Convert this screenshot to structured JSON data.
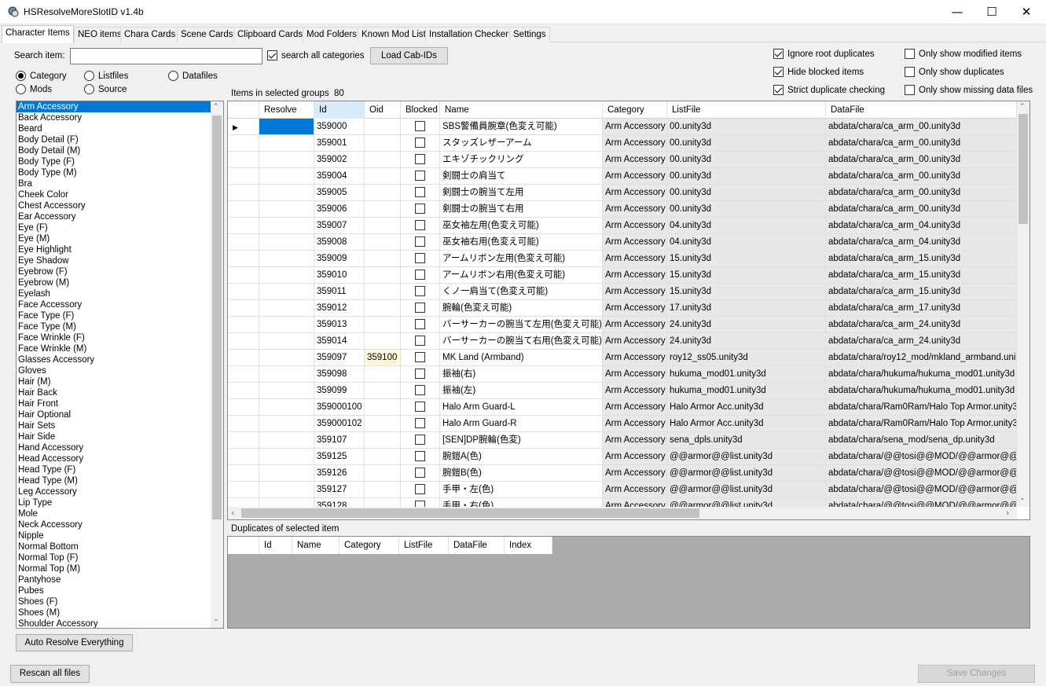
{
  "window": {
    "title": "HSResolveMoreSlotID v1.4b",
    "minimize": "—",
    "maximize": "☐",
    "close": "✕"
  },
  "tabs": [
    "Character Items",
    "NEO items",
    "Chara Cards",
    "Scene Cards",
    "Clipboard Cards",
    "Mod Folders",
    "Known Mod List",
    "Installation Checker",
    "Settings"
  ],
  "search": {
    "label": "Search item:",
    "value": "",
    "all_categories_label": "search all categories",
    "all_categories_checked": true
  },
  "load_cab_button": "Load Cab-IDs",
  "view_modes": {
    "category": "Category",
    "listfiles": "Listfiles",
    "datafiles": "Datafiles",
    "mods": "Mods",
    "source": "Source",
    "selected": "Category"
  },
  "options": {
    "ignore_root_duplicates": {
      "label": "Ignore root duplicates",
      "checked": true
    },
    "hide_blocked_items": {
      "label": "Hide blocked items",
      "checked": true
    },
    "strict_duplicate_checking": {
      "label": "Strict duplicate checking",
      "checked": true
    },
    "only_show_modified_items": {
      "label": "Only show modified items",
      "checked": false
    },
    "only_show_duplicates": {
      "label": "Only show duplicates",
      "checked": false
    },
    "only_show_missing_data_files": {
      "label": "Only show missing data files",
      "checked": false
    }
  },
  "items_count": {
    "label": "Items in selected groups",
    "value": "80"
  },
  "categories": [
    "Arm Accessory",
    "Back Accessory",
    "Beard",
    "Body Detail (F)",
    "Body Detail (M)",
    "Body Type (F)",
    "Body Type (M)",
    "Bra",
    "Cheek Color",
    "Chest Accessory",
    "Ear Accessory",
    "Eye (F)",
    "Eye (M)",
    "Eye Highlight",
    "Eye Shadow",
    "Eyebrow (F)",
    "Eyebrow (M)",
    "Eyelash",
    "Face Accessory",
    "Face Type (F)",
    "Face Type (M)",
    "Face Wrinkle (F)",
    "Face Wrinkle (M)",
    "Glasses Accessory",
    "Gloves",
    "Hair (M)",
    "Hair Back",
    "Hair Front",
    "Hair Optional",
    "Hair Sets",
    "Hair Side",
    "Hand Accessory",
    "Head Accessory",
    "Head Type (F)",
    "Head Type (M)",
    "Leg Accessory",
    "Lip Type",
    "Mole",
    "Neck Accessory",
    "Nipple",
    "Normal Bottom",
    "Normal Top (F)",
    "Normal Top (M)",
    "Pantyhose",
    "Pubes",
    "Shoes (F)",
    "Shoes (M)",
    "Shoulder Accessory"
  ],
  "selected_category": "Arm Accessory",
  "grid": {
    "columns": [
      "Resolve",
      "Id",
      "Oid",
      "Blocked",
      "Name",
      "Category",
      "ListFile",
      "DataFile"
    ],
    "rows": [
      {
        "id": "359000",
        "oid": "",
        "name": "SBS警備員腕章(色変え可能)",
        "cat": "Arm Accessory",
        "lf": "00.unity3d",
        "df": "abdata/chara/ca_arm_00.unity3d"
      },
      {
        "id": "359001",
        "oid": "",
        "name": "スタッズレザーアーム",
        "cat": "Arm Accessory",
        "lf": "00.unity3d",
        "df": "abdata/chara/ca_arm_00.unity3d"
      },
      {
        "id": "359002",
        "oid": "",
        "name": "エキゾチックリング",
        "cat": "Arm Accessory",
        "lf": "00.unity3d",
        "df": "abdata/chara/ca_arm_00.unity3d"
      },
      {
        "id": "359004",
        "oid": "",
        "name": "剣闘士の肩当て",
        "cat": "Arm Accessory",
        "lf": "00.unity3d",
        "df": "abdata/chara/ca_arm_00.unity3d"
      },
      {
        "id": "359005",
        "oid": "",
        "name": "剣闘士の腕当て左用",
        "cat": "Arm Accessory",
        "lf": "00.unity3d",
        "df": "abdata/chara/ca_arm_00.unity3d"
      },
      {
        "id": "359006",
        "oid": "",
        "name": "剣闘士の腕当て右用",
        "cat": "Arm Accessory",
        "lf": "00.unity3d",
        "df": "abdata/chara/ca_arm_00.unity3d"
      },
      {
        "id": "359007",
        "oid": "",
        "name": "巫女袖左用(色変え可能)",
        "cat": "Arm Accessory",
        "lf": "04.unity3d",
        "df": "abdata/chara/ca_arm_04.unity3d"
      },
      {
        "id": "359008",
        "oid": "",
        "name": "巫女袖右用(色変え可能)",
        "cat": "Arm Accessory",
        "lf": "04.unity3d",
        "df": "abdata/chara/ca_arm_04.unity3d"
      },
      {
        "id": "359009",
        "oid": "",
        "name": "アームリボン左用(色変え可能)",
        "cat": "Arm Accessory",
        "lf": "15.unity3d",
        "df": "abdata/chara/ca_arm_15.unity3d"
      },
      {
        "id": "359010",
        "oid": "",
        "name": "アームリボン右用(色変え可能)",
        "cat": "Arm Accessory",
        "lf": "15.unity3d",
        "df": "abdata/chara/ca_arm_15.unity3d"
      },
      {
        "id": "359011",
        "oid": "",
        "name": "くノ一肩当て(色変え可能)",
        "cat": "Arm Accessory",
        "lf": "15.unity3d",
        "df": "abdata/chara/ca_arm_15.unity3d"
      },
      {
        "id": "359012",
        "oid": "",
        "name": "腕輪(色変え可能)",
        "cat": "Arm Accessory",
        "lf": "17.unity3d",
        "df": "abdata/chara/ca_arm_17.unity3d"
      },
      {
        "id": "359013",
        "oid": "",
        "name": "バーサーカーの腕当て左用(色変え可能)",
        "cat": "Arm Accessory",
        "lf": "24.unity3d",
        "df": "abdata/chara/ca_arm_24.unity3d"
      },
      {
        "id": "359014",
        "oid": "",
        "name": "バーサーカーの腕当て右用(色変え可能)",
        "cat": "Arm Accessory",
        "lf": "24.unity3d",
        "df": "abdata/chara/ca_arm_24.unity3d"
      },
      {
        "id": "359097",
        "oid": "359100",
        "name": "MK Land (Armband)",
        "cat": "Arm Accessory",
        "lf": "roy12_ss05.unity3d",
        "df": "abdata/chara/roy12_mod/mkland_armband.unity3d"
      },
      {
        "id": "359098",
        "oid": "",
        "name": "振袖(右)",
        "cat": "Arm Accessory",
        "lf": "hukuma_mod01.unity3d",
        "df": "abdata/chara/hukuma/hukuma_mod01.unity3d"
      },
      {
        "id": "359099",
        "oid": "",
        "name": "振袖(左)",
        "cat": "Arm Accessory",
        "lf": "hukuma_mod01.unity3d",
        "df": "abdata/chara/hukuma/hukuma_mod01.unity3d"
      },
      {
        "id": "359000100",
        "oid": "",
        "name": "Halo Arm Guard-L",
        "cat": "Arm Accessory",
        "lf": "Halo Armor Acc.unity3d",
        "df": "abdata/chara/Ram0Ram/Halo Top Armor.unity3d"
      },
      {
        "id": "359000102",
        "oid": "",
        "name": "Halo Arm Guard-R",
        "cat": "Arm Accessory",
        "lf": "Halo Armor Acc.unity3d",
        "df": "abdata/chara/Ram0Ram/Halo Top Armor.unity3d"
      },
      {
        "id": "359107",
        "oid": "",
        "name": "[SEN]DP腕輪(色変)",
        "cat": "Arm Accessory",
        "lf": "sena_dpls.unity3d",
        "df": "abdata/chara/sena_mod/sena_dp.unity3d"
      },
      {
        "id": "359125",
        "oid": "",
        "name": "腕鎧A(色)",
        "cat": "Arm Accessory",
        "lf": "@@armor@@list.unity3d",
        "df": "abdata/chara/@@tosi@@MOD/@@armor@@.unity3d"
      },
      {
        "id": "359126",
        "oid": "",
        "name": "腕鎧B(色)",
        "cat": "Arm Accessory",
        "lf": "@@armor@@list.unity3d",
        "df": "abdata/chara/@@tosi@@MOD/@@armor@@.unity3d"
      },
      {
        "id": "359127",
        "oid": "",
        "name": "手甲・左(色)",
        "cat": "Arm Accessory",
        "lf": "@@armor@@list.unity3d",
        "df": "abdata/chara/@@tosi@@MOD/@@armor@@.unity3d"
      },
      {
        "id": "359128",
        "oid": "",
        "name": "手甲・右(色)",
        "cat": "Arm Accessory",
        "lf": "@@armor@@list.unity3d",
        "df": "abdata/chara/@@tosi@@MOD/@@armor@@.unity3d"
      }
    ]
  },
  "duplicates": {
    "label": "Duplicates of selected item",
    "columns": [
      "Id",
      "Name",
      "Category",
      "ListFile",
      "DataFile",
      "Index"
    ]
  },
  "auto_resolve_button": "Auto Resolve Everything",
  "rescan_button": "Rescan all files",
  "save_button": "Save Changes"
}
